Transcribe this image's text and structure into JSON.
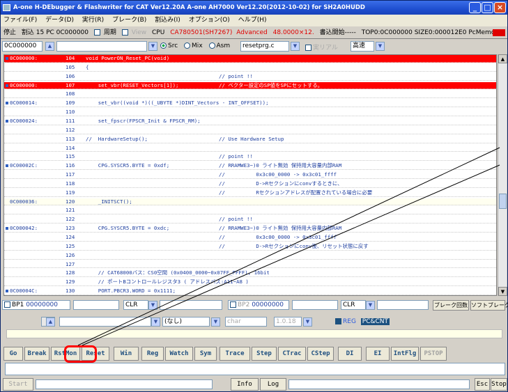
{
  "title": "A-one H-DEbugger & Flashwriter for CAT Ver12.20A A-one AH7000 Ver12.20(2012-10-02) for SH2A0HUDD",
  "menu": [
    "ファイル(F)",
    "データ(D)",
    "実行(R)",
    "ブレーク(B)",
    "割込み(I)",
    "オプション(O)",
    "ヘルプ(H)"
  ],
  "status": {
    "state": "停止",
    "interrupt": "割込 15 PC 0C000000",
    "period_label": "周期",
    "view_label": "View",
    "cpu": "CPU",
    "cpu_id": "CA780501(SH7267)",
    "mode": "Advanced",
    "freq": "48.0000×12.",
    "write_label": "書込開始-----",
    "top": "TOP0:0C000000 SIZE0:000012E0 PcMemory"
  },
  "addr": {
    "address": "0C000000",
    "src": "Src",
    "mix": "Mix",
    "asm": "Asm",
    "file": "resetprg.c",
    "realtime": "実リアル",
    "speed": "高速"
  },
  "code_rows": [
    {
      "addr": "0C000000:",
      "line": "104",
      "text": "void PowerON_Reset_PC(void)",
      "comment": "",
      "style": "hl",
      "mark": true
    },
    {
      "addr": "",
      "line": "105",
      "text": "{",
      "comment": "",
      "style": "",
      "mark": false
    },
    {
      "addr": "",
      "line": "106",
      "text": "",
      "comment": "// point !!",
      "style": "",
      "mark": false
    },
    {
      "addr": "0C000000:",
      "line": "107",
      "text": "    set_vbr(RESET_Vectors[1]);",
      "comment": "// ベクター設定のSP値をSPにセットする。",
      "style": "hl",
      "mark": true
    },
    {
      "addr": "",
      "line": "108",
      "text": "",
      "comment": "",
      "style": "",
      "mark": false
    },
    {
      "addr": "0C000014:",
      "line": "109",
      "text": "    set_vbr((void *)((_UBYTE *)DINT_Vectors - INT_OFFSET));",
      "comment": "",
      "style": "",
      "mark": true
    },
    {
      "addr": "",
      "line": "110",
      "text": "",
      "comment": "",
      "style": "",
      "mark": false
    },
    {
      "addr": "0C000024:",
      "line": "111",
      "text": "    set_fpscr(FPSCR_Init & FPSCR_RM);",
      "comment": "",
      "style": "",
      "mark": true
    },
    {
      "addr": "",
      "line": "112",
      "text": "",
      "comment": "",
      "style": "",
      "mark": false
    },
    {
      "addr": "",
      "line": "113",
      "text": "//  HardwareSetup();",
      "comment": "// Use Hardware Setup",
      "style": "",
      "mark": false
    },
    {
      "addr": "",
      "line": "114",
      "text": "",
      "comment": "",
      "style": "",
      "mark": false
    },
    {
      "addr": "",
      "line": "115",
      "text": "",
      "comment": "// point !!",
      "style": "",
      "mark": false
    },
    {
      "addr": "0C00002C:",
      "line": "116",
      "text": "    CPG.SYSCR5.BYTE = 0xdf;",
      "comment": "// RRAMWE3~)0 ライト無効 保持用大容量内部RAM",
      "style": "",
      "mark": true
    },
    {
      "addr": "",
      "line": "117",
      "text": "",
      "comment": "//          0x3c00_0000 -> 0x3c01_ffff",
      "style": "",
      "mark": false
    },
    {
      "addr": "",
      "line": "118",
      "text": "",
      "comment": "//          D->Rセクションにconvするときに、",
      "style": "",
      "mark": false
    },
    {
      "addr": "",
      "line": "119",
      "text": "",
      "comment": "//          Rセクションアドレスが配置されている場合に必要",
      "style": "",
      "mark": false
    },
    {
      "addr": "0C000036:",
      "line": "120",
      "text": "    _INITSCT();",
      "comment": "",
      "style": "yl",
      "mark": false
    },
    {
      "addr": "",
      "line": "121",
      "text": "",
      "comment": "",
      "style": "",
      "mark": false
    },
    {
      "addr": "",
      "line": "122",
      "text": "",
      "comment": "// point !!",
      "style": "",
      "mark": false
    },
    {
      "addr": "0C000042:",
      "line": "123",
      "text": "    CPG.SYSCR5.BYTE = 0xdc;",
      "comment": "// RRAMWE3~)0 ライト無効 保持用大容量内部RAM",
      "style": "",
      "mark": true
    },
    {
      "addr": "",
      "line": "124",
      "text": "",
      "comment": "//          0x3c00_0000 -> 0x3c01_ffff",
      "style": "",
      "mark": false
    },
    {
      "addr": "",
      "line": "125",
      "text": "",
      "comment": "//          D->Rセクションにconv後、リセット状態に戻す",
      "style": "",
      "mark": false
    },
    {
      "addr": "",
      "line": "126",
      "text": "",
      "comment": "",
      "style": "",
      "mark": false
    },
    {
      "addr": "",
      "line": "127",
      "text": "",
      "comment": "",
      "style": "",
      "mark": false
    },
    {
      "addr": "",
      "line": "128",
      "text": "    // CAT68000バス：CS0空間 (0x0400_0000~0x07FF_FFFF), 16bit",
      "comment": "",
      "style": "",
      "mark": false
    },
    {
      "addr": "",
      "line": "129",
      "text": "    // ポートBコントロールレジスタ3 ( アドレスバス:A11~A8 )",
      "comment": "",
      "style": "",
      "mark": false
    },
    {
      "addr": "0C00004C:",
      "line": "130",
      "text": "    PORT.PBCR3.WORD = 0x1111;",
      "comment": "",
      "style": "",
      "mark": true
    }
  ],
  "bp": {
    "bp1": "BP1",
    "bp1_val": "00000000",
    "clr": "CLR",
    "bp2": "BP2",
    "bp2_val": "00000000",
    "clr2": "CLR",
    "break_label": "ブレーク回数",
    "soft": "ソフトブレーク"
  },
  "log": {
    "nashi": "(なし)",
    "char": "char",
    "bytes": "1.0.18",
    "reg": "REG",
    "radio": "PC&CNT"
  },
  "buttons": [
    "Go",
    "Break",
    "RstMon",
    "Reset",
    "Win",
    "Reg",
    "Watch",
    "Sym",
    "Trace",
    "Step",
    "CTrac",
    "CStep",
    "DI",
    "EI",
    "IntFlg",
    "PSTOP"
  ],
  "bottom": {
    "start": "Start",
    "info": "Info",
    "log": "Log",
    "esc": "Esc",
    "stop": "Stop"
  }
}
